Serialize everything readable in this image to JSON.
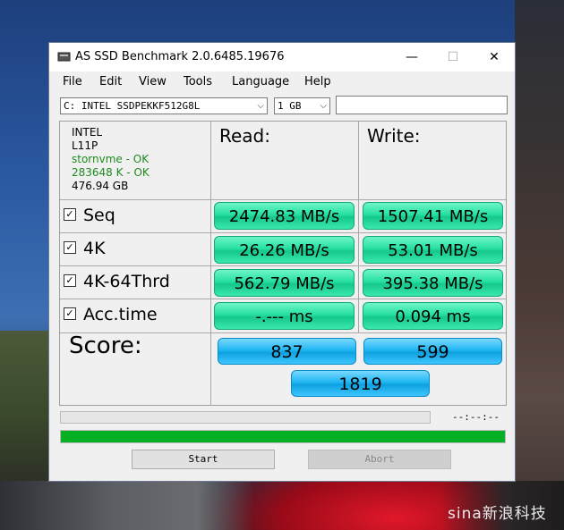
{
  "window": {
    "title": "AS SSD Benchmark 2.0.6485.19676",
    "minimize": "—",
    "maximize": "☐",
    "close": "✕"
  },
  "menu": [
    "File",
    "Edit",
    "View",
    "Tools",
    "Language",
    "Help"
  ],
  "drive_select": {
    "value": "C: INTEL SSDPEKKF512G8L"
  },
  "size_select": {
    "value": "1 GB"
  },
  "drive_info": {
    "vendor": "INTEL",
    "firmware": "L11P",
    "driver_status": "stornvme - OK",
    "alignment_status": "283648 K - OK",
    "capacity": "476.94 GB"
  },
  "headers": {
    "read": "Read:",
    "write": "Write:"
  },
  "rows": [
    {
      "label": "Seq",
      "checked": true,
      "read": "2474.83 MB/s",
      "write": "1507.41 MB/s"
    },
    {
      "label": "4K",
      "checked": true,
      "read": "26.26 MB/s",
      "write": "53.01 MB/s"
    },
    {
      "label": "4K-64Thrd",
      "checked": true,
      "read": "562.79 MB/s",
      "write": "395.38 MB/s"
    },
    {
      "label": "Acc.time",
      "checked": true,
      "read": "-.--- ms",
      "write": "0.094 ms"
    }
  ],
  "score": {
    "label": "Score:",
    "read": "837",
    "write": "599",
    "total": "1819"
  },
  "progress": {
    "time": "--:--:--",
    "overall_fraction": 1.0
  },
  "buttons": {
    "start": "Start",
    "abort": "Abort"
  },
  "watermark": "sina新浪科技",
  "colors": {
    "result_green": "#26e0a2",
    "score_blue": "#1fb6f2",
    "progress_green": "#06b025"
  }
}
